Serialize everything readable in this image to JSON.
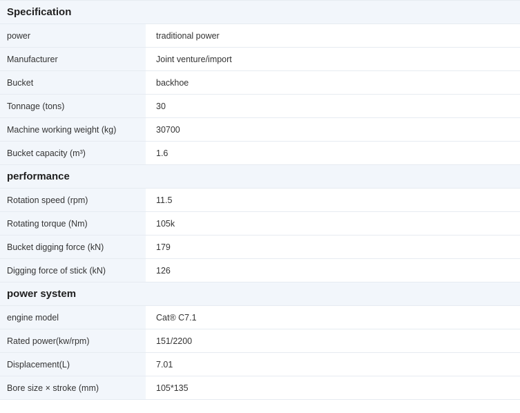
{
  "sections": [
    {
      "title": "Specification",
      "rows": [
        {
          "label": "power",
          "value": "traditional power"
        },
        {
          "label": "Manufacturer",
          "value": "Joint venture/import"
        },
        {
          "label": "Bucket",
          "value": "backhoe"
        },
        {
          "label": "Tonnage (tons)",
          "value": "30"
        },
        {
          "label": "Machine working weight (kg)",
          "value": "30700"
        },
        {
          "label": "Bucket capacity (m³)",
          "value": "1.6"
        }
      ]
    },
    {
      "title": "performance",
      "rows": [
        {
          "label": "Rotation speed (rpm)",
          "value": "11.5"
        },
        {
          "label": "Rotating torque (Nm)",
          "value": "105k"
        },
        {
          "label": "Bucket digging force (kN)",
          "value": "179"
        },
        {
          "label": "Digging force of stick (kN)",
          "value": "126"
        }
      ]
    },
    {
      "title": "power system",
      "rows": [
        {
          "label": "engine model",
          "value": "Cat® C7.1"
        },
        {
          "label": "Rated power(kw/rpm)",
          "value": "151/2200"
        },
        {
          "label": "Displacement(L)",
          "value": "7.01"
        },
        {
          "label": "Bore size × stroke (mm)",
          "value": "105*135"
        }
      ]
    }
  ]
}
